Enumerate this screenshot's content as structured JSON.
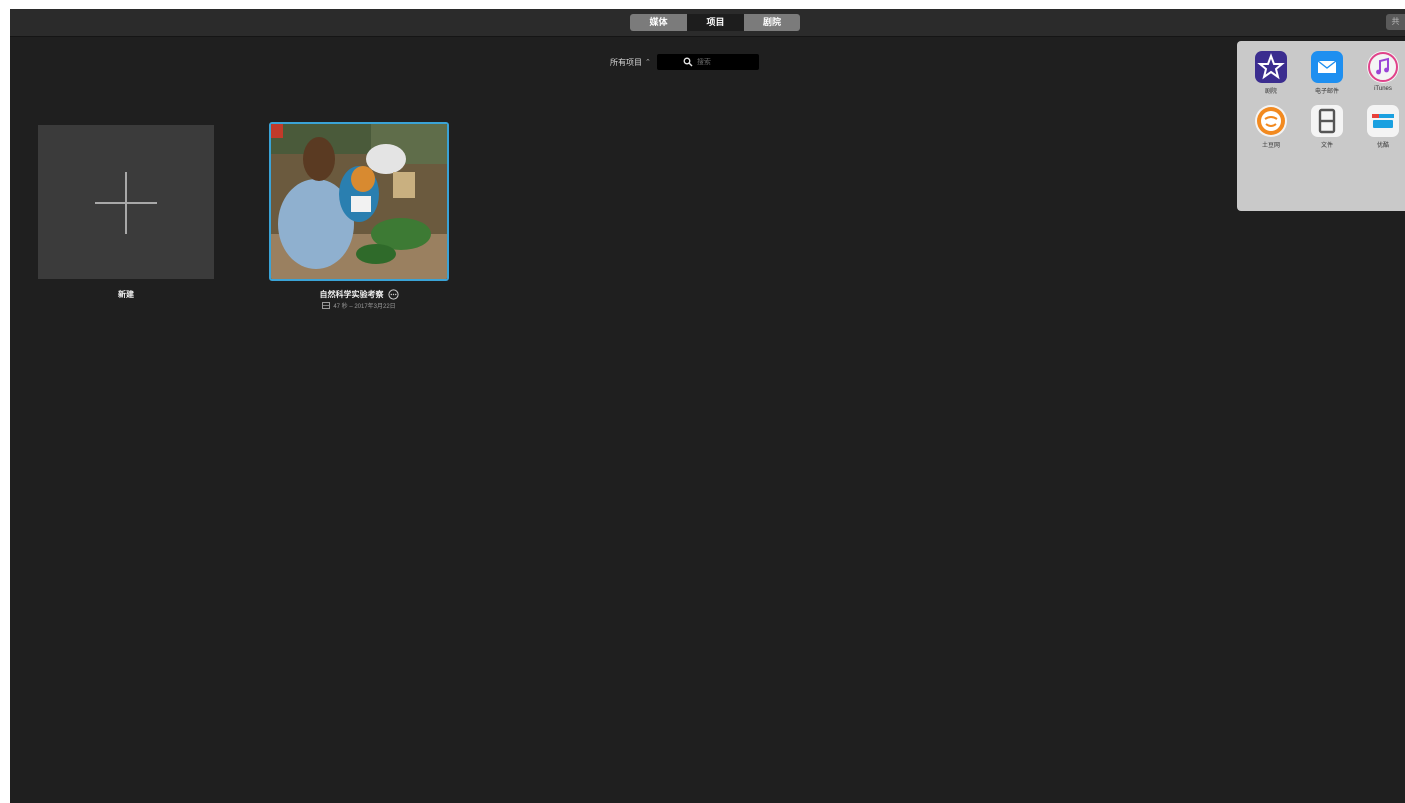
{
  "toolbar": {
    "tabs": [
      {
        "label": "媒体",
        "active": false
      },
      {
        "label": "项目",
        "active": true
      },
      {
        "label": "剧院",
        "active": false
      }
    ],
    "right_button_label": "共"
  },
  "filter": {
    "label": "所有项目",
    "chevron": "⌃"
  },
  "search": {
    "placeholder": "搜索"
  },
  "new_project": {
    "label": "新建"
  },
  "project": {
    "title": "自然科学实验考察",
    "meta": "47 秒 – 2017年3月22日"
  },
  "share_sheet": {
    "items": [
      {
        "label": "剧院",
        "icon": "star-icon",
        "color": "#3b2d8f"
      },
      {
        "label": "电子邮件",
        "icon": "mail-icon",
        "color": "#1e8ff0"
      },
      {
        "label": "iTunes",
        "icon": "music-note-icon",
        "color": "#f4f4f4"
      },
      {
        "label": "土豆网",
        "icon": "tudou-icon",
        "color": "#f4f4f4"
      },
      {
        "label": "文件",
        "icon": "film-icon",
        "color": "#f4f4f4"
      },
      {
        "label": "优酷",
        "icon": "youku-icon",
        "color": "#f4f4f4"
      }
    ]
  },
  "colors": {
    "background": "#1f1f1f",
    "selection": "#3aa3d6"
  }
}
